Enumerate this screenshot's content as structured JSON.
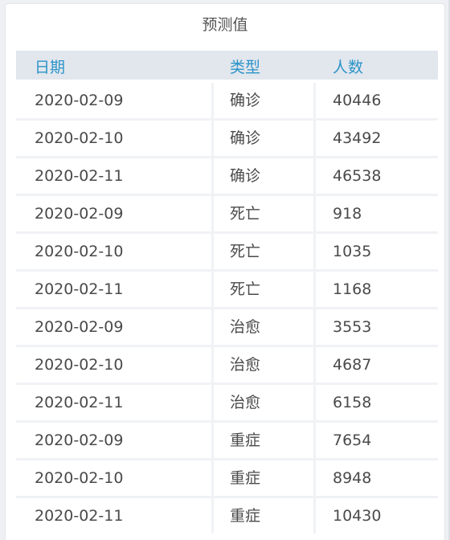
{
  "title": "预测值",
  "table": {
    "columns": [
      "日期",
      "类型",
      "人数"
    ],
    "rows": [
      {
        "date": "2020-02-09",
        "type": "确诊",
        "count": "40446"
      },
      {
        "date": "2020-02-10",
        "type": "确诊",
        "count": "43492"
      },
      {
        "date": "2020-02-11",
        "type": "确诊",
        "count": "46538"
      },
      {
        "date": "2020-02-09",
        "type": "死亡",
        "count": "918"
      },
      {
        "date": "2020-02-10",
        "type": "死亡",
        "count": "1035"
      },
      {
        "date": "2020-02-11",
        "type": "死亡",
        "count": "1168"
      },
      {
        "date": "2020-02-09",
        "type": "治愈",
        "count": "3553"
      },
      {
        "date": "2020-02-10",
        "type": "治愈",
        "count": "4687"
      },
      {
        "date": "2020-02-11",
        "type": "治愈",
        "count": "6158"
      },
      {
        "date": "2020-02-09",
        "type": "重症",
        "count": "7654"
      },
      {
        "date": "2020-02-10",
        "type": "重症",
        "count": "8948"
      },
      {
        "date": "2020-02-11",
        "type": "重症",
        "count": "10430"
      }
    ]
  },
  "colors": {
    "header_text": "#2a94c8",
    "header_bg": "#e2e6ed",
    "body_text": "#4a4a4a"
  }
}
